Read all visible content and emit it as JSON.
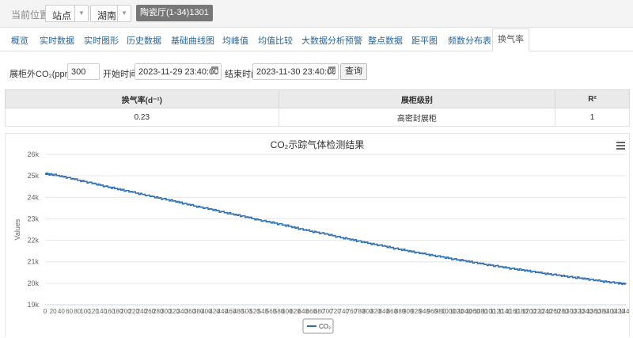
{
  "breadcrumb": {
    "label": "当前位置",
    "site_select": "站点",
    "region_select": "湖南",
    "location_badge": "陶瓷厅(1-34)1301"
  },
  "tabs": [
    {
      "label": "概览"
    },
    {
      "label": "实时数据"
    },
    {
      "label": "实时图形"
    },
    {
      "label": "历史数据"
    },
    {
      "label": "基础曲线图"
    },
    {
      "label": "均峰值"
    },
    {
      "label": "均值比较"
    },
    {
      "label": "大数据分析预警"
    },
    {
      "label": "整点数据"
    },
    {
      "label": "距平图"
    },
    {
      "label": "频数分布表"
    },
    {
      "label": "换气率",
      "active": true
    }
  ],
  "query": {
    "co2_label": "展柜外CO₂(ppm)",
    "co2_value": "300",
    "start_label": "开始时间",
    "start_value": "2023-11-29 23:40:00",
    "end_label": "结束时间",
    "end_value": "2023-11-30 23:40:08",
    "button": "查询"
  },
  "result_table": {
    "headers": [
      "换气率(d⁻¹)",
      "展柜级别",
      "R²"
    ],
    "row": [
      "0.23",
      "高密封展柜",
      "1"
    ]
  },
  "chart_data": {
    "type": "line",
    "title": "CO₂示踪气体检测结果",
    "ylabel": "Values",
    "ylim": [
      19000,
      26000
    ],
    "yticks": [
      19000,
      20000,
      21000,
      22000,
      23000,
      24000,
      25000,
      26000
    ],
    "ytick_labels": [
      "19k",
      "20k",
      "21k",
      "22k",
      "23k",
      "24k",
      "25k",
      "26k"
    ],
    "xlim": [
      0,
      1440
    ],
    "xtick_step": 20,
    "grid": true,
    "legend_position": "bottom-center",
    "series": [
      {
        "name": "CO₂",
        "color": "#2f6fae",
        "x": [
          0,
          20,
          60,
          100,
          140,
          180,
          220,
          260,
          300,
          340,
          380,
          420,
          460,
          500,
          540,
          580,
          620,
          660,
          700,
          740,
          780,
          820,
          860,
          900,
          940,
          980,
          1020,
          1060,
          1100,
          1140,
          1180,
          1220,
          1260,
          1300,
          1340,
          1380,
          1420,
          1440
        ],
        "y": [
          25100,
          25050,
          24900,
          24720,
          24550,
          24380,
          24230,
          24050,
          23900,
          23730,
          23560,
          23400,
          23230,
          23080,
          22900,
          22760,
          22580,
          22420,
          22270,
          22100,
          21950,
          21800,
          21650,
          21500,
          21370,
          21230,
          21100,
          20980,
          20850,
          20730,
          20620,
          20510,
          20400,
          20300,
          20200,
          20100,
          20000,
          19970
        ]
      }
    ]
  },
  "colors": {
    "link": "#2a6496",
    "badge": "#777777",
    "series": "#2f6fae"
  },
  "icons": {
    "menu": "hamburger-icon",
    "calendar": "calendar-icon"
  }
}
